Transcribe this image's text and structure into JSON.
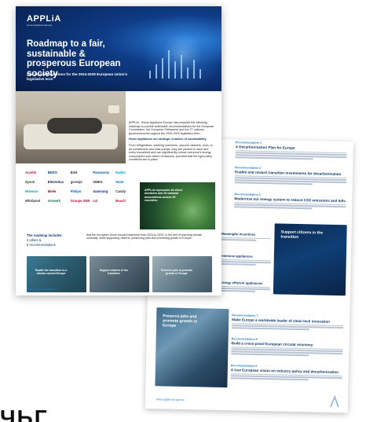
{
  "colors": {
    "hero_blue": "#0f3c86",
    "accent_blue": "#1f7bbf",
    "heading_navy": "#123b6b"
  },
  "front": {
    "logo": "APPLiA",
    "logo_sub": "Home Appliance Europe",
    "title": "Roadmap to a fair, sustainable & prosperous European society",
    "subtitle": "Our recommendations for the 2024-2029 European Union's legislative term",
    "intro_1": "APPLiA - Home Appliance Europe has prepared the following roadmap to provide actionable recommendations for the European Commission, the European Parliament and the 27 national governments throughout the 2024-2029 legislative term.",
    "intro_heading": "Home appliances are strategic enablers of sustainability.",
    "intro_2": "From refrigerators, washing machines, vacuum cleaners, irons, to air conditioners and heat pumps, they are present in each and every household and can significantly reduce everyone's energy consumption and carbon emissions, provided that the right policy conditions are in place.",
    "logos": [
      "Arçelik",
      "BEKO",
      "BSH",
      "Panasonic",
      "Daikin",
      "dyson",
      "Electrolux",
      "gorenje",
      "SMEG",
      "Haier",
      "Hisense",
      "Miele",
      "Philips",
      "Samsung",
      "Candy",
      "Whirlpool",
      "Vorwerk",
      "Groupe SEB",
      "LG",
      "Bosch"
    ],
    "plant_caption": "APPLiA represents 26 direct members and 26 national associations across 29 countries.",
    "roadmap_heading": "The roadmap includes:",
    "roadmap_items": [
      "3 pillars &",
      "9 recommendations"
    ],
    "roadmap_text": "that the European Union should implement from 2024 to 2029, in the aim of reaching climate neutrality, while supporting citizens, preserving jobs and promoting growth in Europe.",
    "strip_captions": [
      "Enable the transition to a climate-neutral Europe",
      "Support citizens in the transition",
      "Preserve jobs & promote growth in Europe"
    ],
    "footer": "www.applia-europe.eu"
  },
  "back": {
    "recommendations": [
      {
        "kicker": "Recommendation 1",
        "title": "A Decarbonisation Plan for Europe"
      },
      {
        "kicker": "Recommendation 2",
        "title": "Enable and reward transition investments for decarbonisation"
      },
      {
        "kicker": "Recommendation 3",
        "title": "Modernise our energy system to reduce CO2 emissions and bills"
      }
    ],
    "image_1_caption": "Support citizens in the transition",
    "side_blocks": [
      "Meaningful incentives",
      "Intensive appliances",
      "Energy efficient appliances"
    ],
    "image_2_caption": "Preserve jobs and promote growth in Europe",
    "recommendations_lower": [
      {
        "kicker": "Recommendation 7",
        "title": "Make Europe a worldwide leader of clean tech innovation"
      },
      {
        "kicker": "Recommendation 8",
        "title": "Build a cross-proof European circular economy"
      },
      {
        "kicker": "Recommendation 9",
        "title": "A true European vision on industry policy and decarbonisation"
      }
    ],
    "footer": "www.applia-europe.eu"
  },
  "bottom_text": "ЧЬГ"
}
